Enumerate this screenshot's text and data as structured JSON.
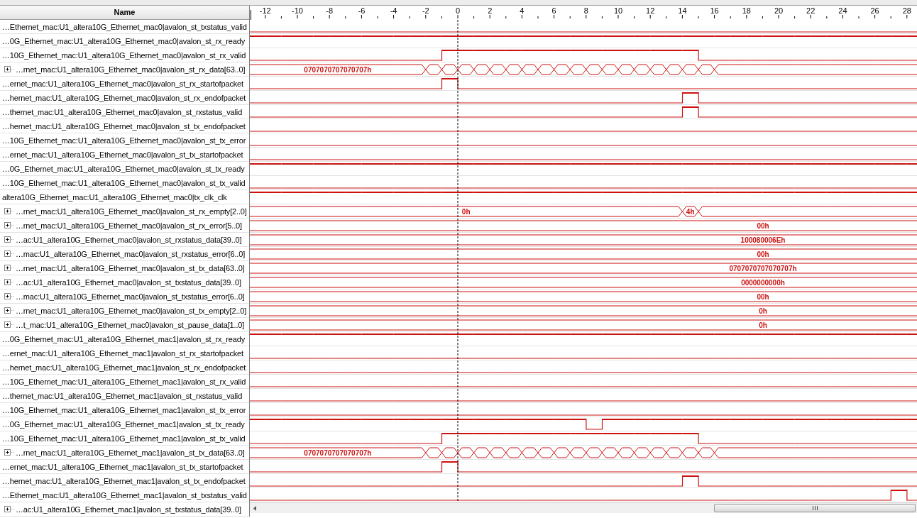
{
  "name_header": "Name",
  "ruler": {
    "ticks": [
      {
        "label": "-12",
        "cursor": false
      },
      {
        "label": "-10",
        "cursor": false
      },
      {
        "label": "-8",
        "cursor": false
      },
      {
        "label": "-6",
        "cursor": false
      },
      {
        "label": "-4",
        "cursor": false
      },
      {
        "label": "-2",
        "cursor": false
      },
      {
        "label": "0",
        "cursor": true
      },
      {
        "label": "2",
        "cursor": false
      },
      {
        "label": "4",
        "cursor": false
      },
      {
        "label": "6",
        "cursor": false
      },
      {
        "label": "8",
        "cursor": false
      },
      {
        "label": "10",
        "cursor": false
      },
      {
        "label": "12",
        "cursor": false
      },
      {
        "label": "14",
        "cursor": false
      },
      {
        "label": "16",
        "cursor": false
      },
      {
        "label": "18",
        "cursor": false
      },
      {
        "label": "20",
        "cursor": false
      },
      {
        "label": "22",
        "cursor": false
      },
      {
        "label": "24",
        "cursor": false
      },
      {
        "label": "26",
        "cursor": false
      },
      {
        "label": "28",
        "cursor": false
      }
    ]
  },
  "signals": [
    {
      "name": "…Ethernet_mac:U1_altera10G_Ethernet_mac0|avalon_st_txstatus_valid",
      "expandable": false,
      "kind": "bit",
      "high": [
        false,
        false,
        false,
        false,
        false,
        false,
        false,
        false,
        false,
        false,
        false,
        false,
        false,
        false,
        false,
        false,
        false,
        false,
        false,
        false,
        false,
        false,
        false,
        false,
        false,
        false,
        false,
        false,
        false,
        false,
        false,
        false,
        false,
        false,
        false,
        false,
        false,
        false,
        false,
        false,
        false,
        false
      ]
    },
    {
      "name": "…0G_Ethernet_mac:U1_altera10G_Ethernet_mac0|avalon_st_rx_ready",
      "expandable": false,
      "kind": "bit",
      "high": [
        true,
        true,
        true,
        true,
        true,
        true,
        true,
        true,
        true,
        true,
        true,
        true,
        true,
        true,
        true,
        true,
        true,
        true,
        true,
        true,
        true,
        true,
        true,
        true,
        true,
        true,
        true,
        true,
        true,
        true,
        true,
        true,
        true,
        true,
        true,
        true,
        true,
        true,
        true,
        true,
        true,
        true
      ]
    },
    {
      "name": "…10G_Ethernet_mac:U1_altera10G_Ethernet_mac0|avalon_st_rx_valid",
      "expandable": false,
      "kind": "bit",
      "high": [
        false,
        false,
        false,
        false,
        false,
        false,
        false,
        false,
        false,
        false,
        false,
        false,
        true,
        true,
        true,
        true,
        true,
        true,
        true,
        true,
        true,
        true,
        true,
        true,
        true,
        true,
        true,
        true,
        false,
        false,
        false,
        false,
        false,
        false,
        false,
        false,
        false,
        false,
        false,
        false,
        false,
        false
      ]
    },
    {
      "name": "…rnet_mac:U1_altera10G_Ethernet_mac0|avalon_st_rx_data[63..0]",
      "expandable": true,
      "kind": "bus",
      "labels": [
        "0707070707070707h"
      ],
      "transitions": [
        false,
        false,
        false,
        false,
        false,
        false,
        false,
        false,
        false,
        false,
        false,
        true,
        true,
        true,
        true,
        true,
        true,
        true,
        true,
        true,
        true,
        true,
        true,
        true,
        true,
        true,
        true,
        true,
        true,
        true,
        false,
        false,
        false,
        false,
        false,
        false,
        false,
        false,
        false,
        false,
        false,
        false
      ]
    },
    {
      "name": "…ernet_mac:U1_altera10G_Ethernet_mac0|avalon_st_rx_startofpacket",
      "expandable": false,
      "kind": "bit",
      "high": [
        false,
        false,
        false,
        false,
        false,
        false,
        false,
        false,
        false,
        false,
        false,
        false,
        true,
        false,
        false,
        false,
        false,
        false,
        false,
        false,
        false,
        false,
        false,
        false,
        false,
        false,
        false,
        false,
        false,
        false,
        false,
        false,
        false,
        false,
        false,
        false,
        false,
        false,
        false,
        false,
        false,
        false
      ]
    },
    {
      "name": "…hernet_mac:U1_altera10G_Ethernet_mac0|avalon_st_rx_endofpacket",
      "expandable": false,
      "kind": "bit",
      "high": [
        false,
        false,
        false,
        false,
        false,
        false,
        false,
        false,
        false,
        false,
        false,
        false,
        false,
        false,
        false,
        false,
        false,
        false,
        false,
        false,
        false,
        false,
        false,
        false,
        false,
        false,
        false,
        true,
        false,
        false,
        false,
        false,
        false,
        false,
        false,
        false,
        false,
        false,
        false,
        false,
        false,
        false
      ]
    },
    {
      "name": "…thernet_mac:U1_altera10G_Ethernet_mac0|avalon_st_rxstatus_valid",
      "expandable": false,
      "kind": "bit",
      "high": [
        false,
        false,
        false,
        false,
        false,
        false,
        false,
        false,
        false,
        false,
        false,
        false,
        false,
        false,
        false,
        false,
        false,
        false,
        false,
        false,
        false,
        false,
        false,
        false,
        false,
        false,
        false,
        true,
        false,
        false,
        false,
        false,
        false,
        false,
        false,
        false,
        false,
        false,
        false,
        false,
        false,
        false
      ]
    },
    {
      "name": "…hernet_mac:U1_altera10G_Ethernet_mac0|avalon_st_tx_endofpacket",
      "expandable": false,
      "kind": "bit",
      "high": [
        false,
        false,
        false,
        false,
        false,
        false,
        false,
        false,
        false,
        false,
        false,
        false,
        false,
        false,
        false,
        false,
        false,
        false,
        false,
        false,
        false,
        false,
        false,
        false,
        false,
        false,
        false,
        false,
        false,
        false,
        false,
        false,
        false,
        false,
        false,
        false,
        false,
        false,
        false,
        false,
        false,
        false
      ]
    },
    {
      "name": "…10G_Ethernet_mac:U1_altera10G_Ethernet_mac0|avalon_st_tx_error",
      "expandable": false,
      "kind": "bit",
      "high": [
        false,
        false,
        false,
        false,
        false,
        false,
        false,
        false,
        false,
        false,
        false,
        false,
        false,
        false,
        false,
        false,
        false,
        false,
        false,
        false,
        false,
        false,
        false,
        false,
        false,
        false,
        false,
        false,
        false,
        false,
        false,
        false,
        false,
        false,
        false,
        false,
        false,
        false,
        false,
        false,
        false,
        false
      ]
    },
    {
      "name": "…ernet_mac:U1_altera10G_Ethernet_mac0|avalon_st_tx_startofpacket",
      "expandable": false,
      "kind": "bit",
      "high": [
        false,
        false,
        false,
        false,
        false,
        false,
        false,
        false,
        false,
        false,
        false,
        false,
        false,
        false,
        false,
        false,
        false,
        false,
        false,
        false,
        false,
        false,
        false,
        false,
        false,
        false,
        false,
        false,
        false,
        false,
        false,
        false,
        false,
        false,
        false,
        false,
        false,
        false,
        false,
        false,
        false,
        false
      ]
    },
    {
      "name": "…0G_Ethernet_mac:U1_altera10G_Ethernet_mac0|avalon_st_tx_ready",
      "expandable": false,
      "kind": "bit",
      "high": [
        true,
        true,
        true,
        true,
        true,
        true,
        true,
        true,
        true,
        true,
        true,
        true,
        true,
        true,
        true,
        true,
        true,
        true,
        true,
        true,
        true,
        true,
        true,
        true,
        true,
        true,
        true,
        true,
        true,
        true,
        true,
        true,
        true,
        true,
        true,
        true,
        true,
        true,
        true,
        true,
        true,
        true
      ]
    },
    {
      "name": "…10G_Ethernet_mac:U1_altera10G_Ethernet_mac0|avalon_st_tx_valid",
      "expandable": false,
      "kind": "bit",
      "high": [
        false,
        false,
        false,
        false,
        false,
        false,
        false,
        false,
        false,
        false,
        false,
        false,
        false,
        false,
        false,
        false,
        false,
        false,
        false,
        false,
        false,
        false,
        false,
        false,
        false,
        false,
        false,
        false,
        false,
        false,
        false,
        false,
        false,
        false,
        false,
        false,
        false,
        false,
        false,
        false,
        false,
        false
      ]
    },
    {
      "name": "altera10G_Ethernet_mac:U1_altera10G_Ethernet_mac0|tx_clk_clk",
      "expandable": false,
      "kind": "bit",
      "high": [
        true,
        true,
        true,
        true,
        true,
        true,
        true,
        true,
        true,
        true,
        true,
        true,
        true,
        true,
        true,
        true,
        true,
        true,
        true,
        true,
        true,
        true,
        true,
        true,
        true,
        true,
        true,
        true,
        true,
        true,
        true,
        true,
        true,
        true,
        true,
        true,
        true,
        true,
        true,
        true,
        true,
        true
      ]
    },
    {
      "name": "…rnet_mac:U1_altera10G_Ethernet_mac0|avalon_st_rx_empty[2..0]",
      "expandable": true,
      "kind": "bus",
      "labels": [
        "0h",
        "4h"
      ],
      "transitions": [
        false,
        false,
        false,
        false,
        false,
        false,
        false,
        false,
        false,
        false,
        false,
        false,
        false,
        false,
        false,
        false,
        false,
        false,
        false,
        false,
        false,
        false,
        false,
        false,
        false,
        false,
        false,
        true,
        true,
        false,
        false,
        false,
        false,
        false,
        false,
        false,
        false,
        false,
        false,
        false,
        false,
        false
      ]
    },
    {
      "name": "…rnet_mac:U1_altera10G_Ethernet_mac0|avalon_st_rx_error[5..0]",
      "expandable": true,
      "kind": "bus",
      "labels": [
        "00h"
      ]
    },
    {
      "name": "…ac:U1_altera10G_Ethernet_mac0|avalon_st_rxstatus_data[39..0]",
      "expandable": true,
      "kind": "bus",
      "labels": [
        "100080006Eh"
      ]
    },
    {
      "name": "…mac:U1_altera10G_Ethernet_mac0|avalon_st_rxstatus_error[6..0]",
      "expandable": true,
      "kind": "bus",
      "labels": [
        "00h"
      ]
    },
    {
      "name": "…rnet_mac:U1_altera10G_Ethernet_mac0|avalon_st_tx_data[63..0]",
      "expandable": true,
      "kind": "bus",
      "labels": [
        "0707070707070707h"
      ]
    },
    {
      "name": "…ac:U1_altera10G_Ethernet_mac0|avalon_st_txstatus_data[39..0]",
      "expandable": true,
      "kind": "bus",
      "labels": [
        "0000000000h"
      ]
    },
    {
      "name": "…mac:U1_altera10G_Ethernet_mac0|avalon_st_txstatus_error[6..0]",
      "expandable": true,
      "kind": "bus",
      "labels": [
        "00h"
      ]
    },
    {
      "name": "…rnet_mac:U1_altera10G_Ethernet_mac0|avalon_st_tx_empty[2..0]",
      "expandable": true,
      "kind": "bus",
      "labels": [
        "0h"
      ]
    },
    {
      "name": "…t_mac:U1_altera10G_Ethernet_mac0|avalon_st_pause_data[1..0]",
      "expandable": true,
      "kind": "bus",
      "labels": [
        "0h"
      ]
    },
    {
      "name": "…0G_Ethernet_mac:U1_altera10G_Ethernet_mac1|avalon_st_rx_ready",
      "expandable": false,
      "kind": "bit",
      "high": [
        true,
        true,
        true,
        true,
        true,
        true,
        true,
        true,
        true,
        true,
        true,
        true,
        true,
        true,
        true,
        true,
        true,
        true,
        true,
        true,
        true,
        true,
        true,
        true,
        true,
        true,
        true,
        true,
        true,
        true,
        true,
        true,
        true,
        true,
        true,
        true,
        true,
        true,
        true,
        true,
        true,
        true
      ]
    },
    {
      "name": "…ernet_mac:U1_altera10G_Ethernet_mac1|avalon_st_rx_startofpacket",
      "expandable": false,
      "kind": "bit",
      "high": [
        false,
        false,
        false,
        false,
        false,
        false,
        false,
        false,
        false,
        false,
        false,
        false,
        false,
        false,
        false,
        false,
        false,
        false,
        false,
        false,
        false,
        false,
        false,
        false,
        false,
        false,
        false,
        false,
        false,
        false,
        false,
        false,
        false,
        false,
        false,
        false,
        false,
        false,
        false,
        false,
        false,
        false
      ]
    },
    {
      "name": "…hernet_mac:U1_altera10G_Ethernet_mac1|avalon_st_rx_endofpacket",
      "expandable": false,
      "kind": "bit",
      "high": [
        false,
        false,
        false,
        false,
        false,
        false,
        false,
        false,
        false,
        false,
        false,
        false,
        false,
        false,
        false,
        false,
        false,
        false,
        false,
        false,
        false,
        false,
        false,
        false,
        false,
        false,
        false,
        false,
        false,
        false,
        false,
        false,
        false,
        false,
        false,
        false,
        false,
        false,
        false,
        false,
        false,
        false
      ]
    },
    {
      "name": "…10G_Ethernet_mac:U1_altera10G_Ethernet_mac1|avalon_st_rx_valid",
      "expandable": false,
      "kind": "bit",
      "high": [
        false,
        false,
        false,
        false,
        false,
        false,
        false,
        false,
        false,
        false,
        false,
        false,
        false,
        false,
        false,
        false,
        false,
        false,
        false,
        false,
        false,
        false,
        false,
        false,
        false,
        false,
        false,
        false,
        false,
        false,
        false,
        false,
        false,
        false,
        false,
        false,
        false,
        false,
        false,
        false,
        false,
        false
      ]
    },
    {
      "name": "…thernet_mac:U1_altera10G_Ethernet_mac1|avalon_st_rxstatus_valid",
      "expandable": false,
      "kind": "bit",
      "high": [
        false,
        false,
        false,
        false,
        false,
        false,
        false,
        false,
        false,
        false,
        false,
        false,
        false,
        false,
        false,
        false,
        false,
        false,
        false,
        false,
        false,
        false,
        false,
        false,
        false,
        false,
        false,
        false,
        false,
        false,
        false,
        false,
        false,
        false,
        false,
        false,
        false,
        false,
        false,
        false,
        false,
        false
      ]
    },
    {
      "name": "…10G_Ethernet_mac:U1_altera10G_Ethernet_mac1|avalon_st_tx_error",
      "expandable": false,
      "kind": "bit",
      "high": [
        false,
        false,
        false,
        false,
        false,
        false,
        false,
        false,
        false,
        false,
        false,
        false,
        false,
        false,
        false,
        false,
        false,
        false,
        false,
        false,
        false,
        false,
        false,
        false,
        false,
        false,
        false,
        false,
        false,
        false,
        false,
        false,
        false,
        false,
        false,
        false,
        false,
        false,
        false,
        false,
        false,
        false
      ]
    },
    {
      "name": "…0G_Ethernet_mac:U1_altera10G_Ethernet_mac1|avalon_st_tx_ready",
      "expandable": false,
      "kind": "bit",
      "high": [
        true,
        true,
        true,
        true,
        true,
        true,
        true,
        true,
        true,
        true,
        true,
        true,
        true,
        true,
        true,
        true,
        true,
        true,
        true,
        true,
        true,
        false,
        true,
        true,
        true,
        true,
        true,
        true,
        true,
        true,
        true,
        true,
        true,
        true,
        true,
        true,
        true,
        true,
        true,
        true,
        true,
        true
      ]
    },
    {
      "name": "…10G_Ethernet_mac:U1_altera10G_Ethernet_mac1|avalon_st_tx_valid",
      "expandable": false,
      "kind": "bit",
      "high": [
        false,
        false,
        false,
        false,
        false,
        false,
        false,
        false,
        false,
        false,
        false,
        false,
        true,
        true,
        true,
        true,
        true,
        true,
        true,
        true,
        true,
        true,
        true,
        true,
        true,
        true,
        true,
        true,
        false,
        false,
        false,
        false,
        false,
        false,
        false,
        false,
        false,
        false,
        false,
        false,
        false,
        false
      ]
    },
    {
      "name": "…rnet_mac:U1_altera10G_Ethernet_mac1|avalon_st_tx_data[63..0]",
      "expandable": true,
      "kind": "bus",
      "labels": [
        "0707070707070707h"
      ],
      "transitions": [
        false,
        false,
        false,
        false,
        false,
        false,
        false,
        false,
        false,
        false,
        false,
        true,
        true,
        true,
        true,
        true,
        true,
        true,
        true,
        true,
        true,
        true,
        true,
        true,
        true,
        true,
        true,
        true,
        true,
        true,
        false,
        false,
        false,
        false,
        false,
        false,
        false,
        false,
        false,
        false,
        false,
        false
      ]
    },
    {
      "name": "…ernet_mac:U1_altera10G_Ethernet_mac1|avalon_st_tx_startofpacket",
      "expandable": false,
      "kind": "bit",
      "high": [
        false,
        false,
        false,
        false,
        false,
        false,
        false,
        false,
        false,
        false,
        false,
        false,
        true,
        false,
        false,
        false,
        false,
        false,
        false,
        false,
        false,
        false,
        false,
        false,
        false,
        false,
        false,
        false,
        false,
        false,
        false,
        false,
        false,
        false,
        false,
        false,
        false,
        false,
        false,
        false,
        false,
        false
      ]
    },
    {
      "name": "…hernet_mac:U1_altera10G_Ethernet_mac1|avalon_st_tx_endofpacket",
      "expandable": false,
      "kind": "bit",
      "high": [
        false,
        false,
        false,
        false,
        false,
        false,
        false,
        false,
        false,
        false,
        false,
        false,
        false,
        false,
        false,
        false,
        false,
        false,
        false,
        false,
        false,
        false,
        false,
        false,
        false,
        false,
        false,
        true,
        false,
        false,
        false,
        false,
        false,
        false,
        false,
        false,
        false,
        false,
        false,
        false,
        false,
        false
      ]
    },
    {
      "name": "…Ethernet_mac:U1_altera10G_Ethernet_mac1|avalon_st_txstatus_valid",
      "expandable": false,
      "kind": "bit",
      "high": [
        false,
        false,
        false,
        false,
        false,
        false,
        false,
        false,
        false,
        false,
        false,
        false,
        false,
        false,
        false,
        false,
        false,
        false,
        false,
        false,
        false,
        false,
        false,
        false,
        false,
        false,
        false,
        false,
        false,
        false,
        false,
        false,
        false,
        false,
        false,
        false,
        false,
        false,
        false,
        false,
        true,
        false
      ]
    },
    {
      "name": "…ac:U1_altera10G_Ethernet_mac1|avalon_st_txstatus_data[39..0]",
      "expandable": true
    }
  ]
}
